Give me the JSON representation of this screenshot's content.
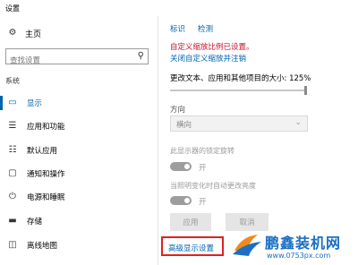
{
  "window": {
    "title": "设置"
  },
  "sidebar": {
    "home_label": "主页",
    "search": {
      "placeholder": "查找设置"
    },
    "section_label": "系统",
    "items": [
      {
        "label": "显示",
        "icon": "monitor-icon",
        "active": true
      },
      {
        "label": "应用和功能",
        "icon": "apps-icon"
      },
      {
        "label": "默认应用",
        "icon": "default-apps-icon"
      },
      {
        "label": "通知和操作",
        "icon": "notifications-icon"
      },
      {
        "label": "电源和睡眠",
        "icon": "power-icon"
      },
      {
        "label": "存储",
        "icon": "storage-icon"
      },
      {
        "label": "离线地图",
        "icon": "map-icon"
      }
    ]
  },
  "main": {
    "identify_label": "标识",
    "detect_label": "检测",
    "custom_scale_warning": "自定义缩放比例已设置。",
    "turn_off_custom_scaling": "关闭自定义缩放并注销",
    "scale_label": "更改文本、应用和其他项目的大小: 125%",
    "orientation_label": "方向",
    "orientation_value": "横向",
    "rotation_lock_label": "此显示器的锁定旋转",
    "rotation_lock_state": "开",
    "auto_brightness_label": "当照明变化时自动更改亮度",
    "auto_brightness_state": "开",
    "apply_label": "应用",
    "cancel_label": "取消",
    "advanced_display_settings": "高级显示设置"
  },
  "watermark": {
    "brand": "鹏鑫装机网",
    "url": "www.0753px.com"
  },
  "colors": {
    "accent": "#0063b1",
    "warning": "#c8102e",
    "highlight_frame": "#e02020"
  }
}
